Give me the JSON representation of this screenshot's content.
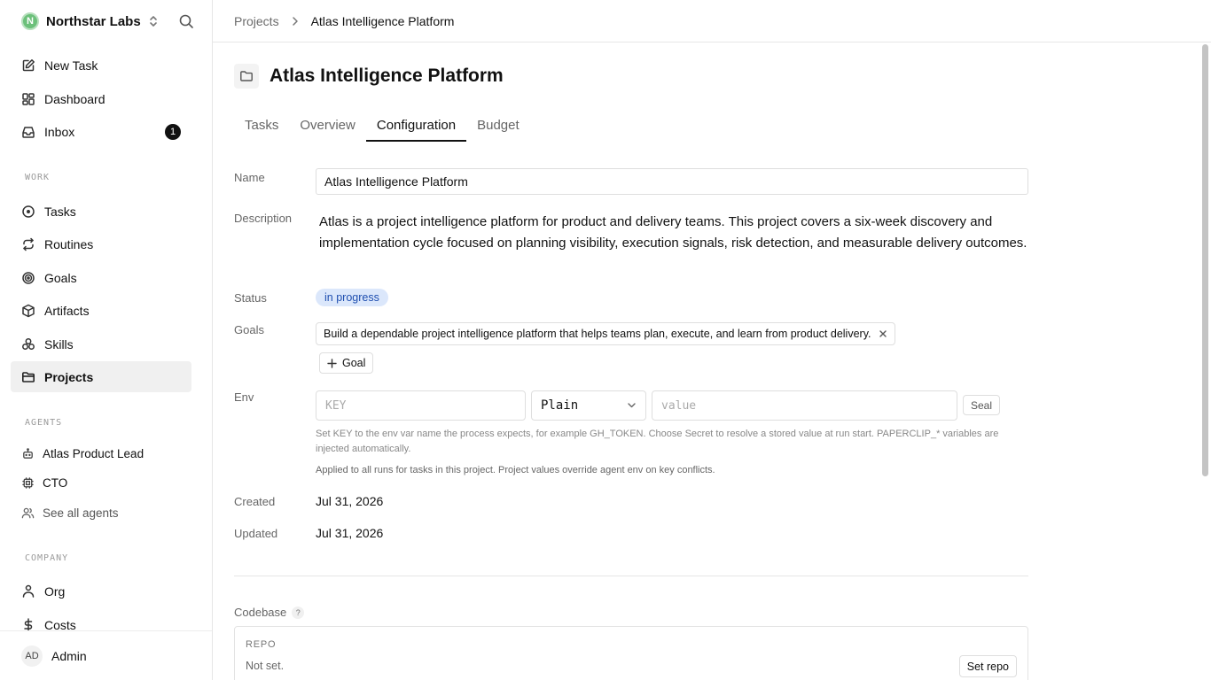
{
  "colors": {
    "active_bg": "#f0f0f0",
    "status_bg": "#dbe7fb",
    "status_fg": "#1f4fb0",
    "logo": "#6cc07a"
  },
  "workspace": {
    "initial": "N",
    "name": "Northstar Labs"
  },
  "sidebar": {
    "top_items": [
      {
        "label": "New Task",
        "icon": "edit-icon"
      },
      {
        "label": "Dashboard",
        "icon": "dashboard-icon"
      },
      {
        "label": "Inbox",
        "icon": "inbox-icon",
        "badge": "1"
      }
    ],
    "work_label": "WORK",
    "work_items": [
      {
        "label": "Tasks",
        "icon": "circle-dot-icon"
      },
      {
        "label": "Routines",
        "icon": "repeat-icon"
      },
      {
        "label": "Goals",
        "icon": "target-icon"
      },
      {
        "label": "Artifacts",
        "icon": "box-icon"
      },
      {
        "label": "Skills",
        "icon": "skills-icon"
      },
      {
        "label": "Projects",
        "icon": "folder-icon"
      }
    ],
    "agents_label": "AGENTS",
    "agents": [
      {
        "label": "Atlas Product Lead",
        "icon": "bot-icon"
      },
      {
        "label": "CTO",
        "icon": "cpu-icon"
      },
      {
        "label": "See all agents",
        "icon": "users-icon"
      }
    ],
    "company_label": "COMPANY",
    "company_items": [
      {
        "label": "Org",
        "icon": "org-icon"
      },
      {
        "label": "Costs",
        "icon": "dollar-icon"
      }
    ],
    "footer": {
      "initials": "AD",
      "name": "Admin"
    }
  },
  "breadcrumb": {
    "parent": "Projects",
    "current": "Atlas Intelligence Platform"
  },
  "project": {
    "title": "Atlas Intelligence Platform"
  },
  "tabs": [
    "Tasks",
    "Overview",
    "Configuration",
    "Budget"
  ],
  "form": {
    "name_label": "Name",
    "name_value": "Atlas Intelligence Platform",
    "description_label": "Description",
    "description": "Atlas is a project intelligence platform for product and delivery teams. This project covers a six-week discovery and implementation cycle focused on planning visibility, execution signals, risk detection, and measurable delivery outcomes.",
    "status_label": "Status",
    "status": "in progress",
    "goals_label": "Goals",
    "goal": "Build a dependable project intelligence platform that helps teams plan, execute, and learn from product delivery.",
    "add_goal": "Goal",
    "env_label": "Env",
    "env_key_placeholder": "KEY",
    "env_type": "Plain",
    "env_value_placeholder": "value",
    "seal": "Seal",
    "env_hint": "Set KEY to the env var name the process expects, for example GH_TOKEN. Choose Secret to resolve a stored value at run start. PAPERCLIP_* variables are injected automatically.",
    "env_note": "Applied to all runs for tasks in this project. Project values override agent env on key conflicts.",
    "created_label": "Created",
    "created": "Jul 31, 2026",
    "updated_label": "Updated",
    "updated": "Jul 31, 2026"
  },
  "codebase": {
    "label": "Codebase",
    "help": "?",
    "repo_label": "REPO",
    "repo_value": "Not set.",
    "set_repo": "Set repo"
  }
}
